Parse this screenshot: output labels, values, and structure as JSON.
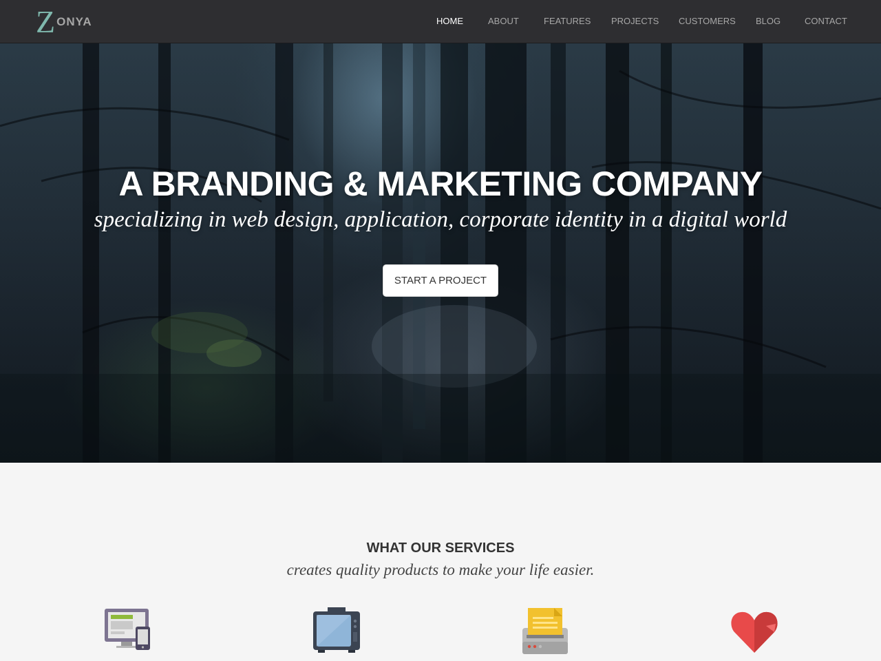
{
  "brand": {
    "logo_letter": "Z",
    "logo_rest": "ONYA"
  },
  "nav": {
    "items": [
      "HOME",
      "ABOUT",
      "FEATURES",
      "PROJECTS",
      "CUSTOMERS",
      "BLOG",
      "CONTACT"
    ],
    "active": "HOME"
  },
  "hero": {
    "title": "A BRANDING & MARKETING COMPANY",
    "subtitle": "specializing in web design, application, corporate identity in a digital world",
    "cta_label": "START A PROJECT"
  },
  "services": {
    "title": "WHAT OUR SERVICES",
    "subtitle": "creates quality products to make your life easier.",
    "icons": [
      "devices-icon",
      "tv-icon",
      "printer-icon",
      "heart-icon"
    ]
  },
  "colors": {
    "navbar_bg": "#2e2e31",
    "logo_accent": "#7fb8ad",
    "nav_text": "#a8a8a8",
    "nav_active": "#ffffff",
    "section_bg": "#f5f5f5"
  }
}
